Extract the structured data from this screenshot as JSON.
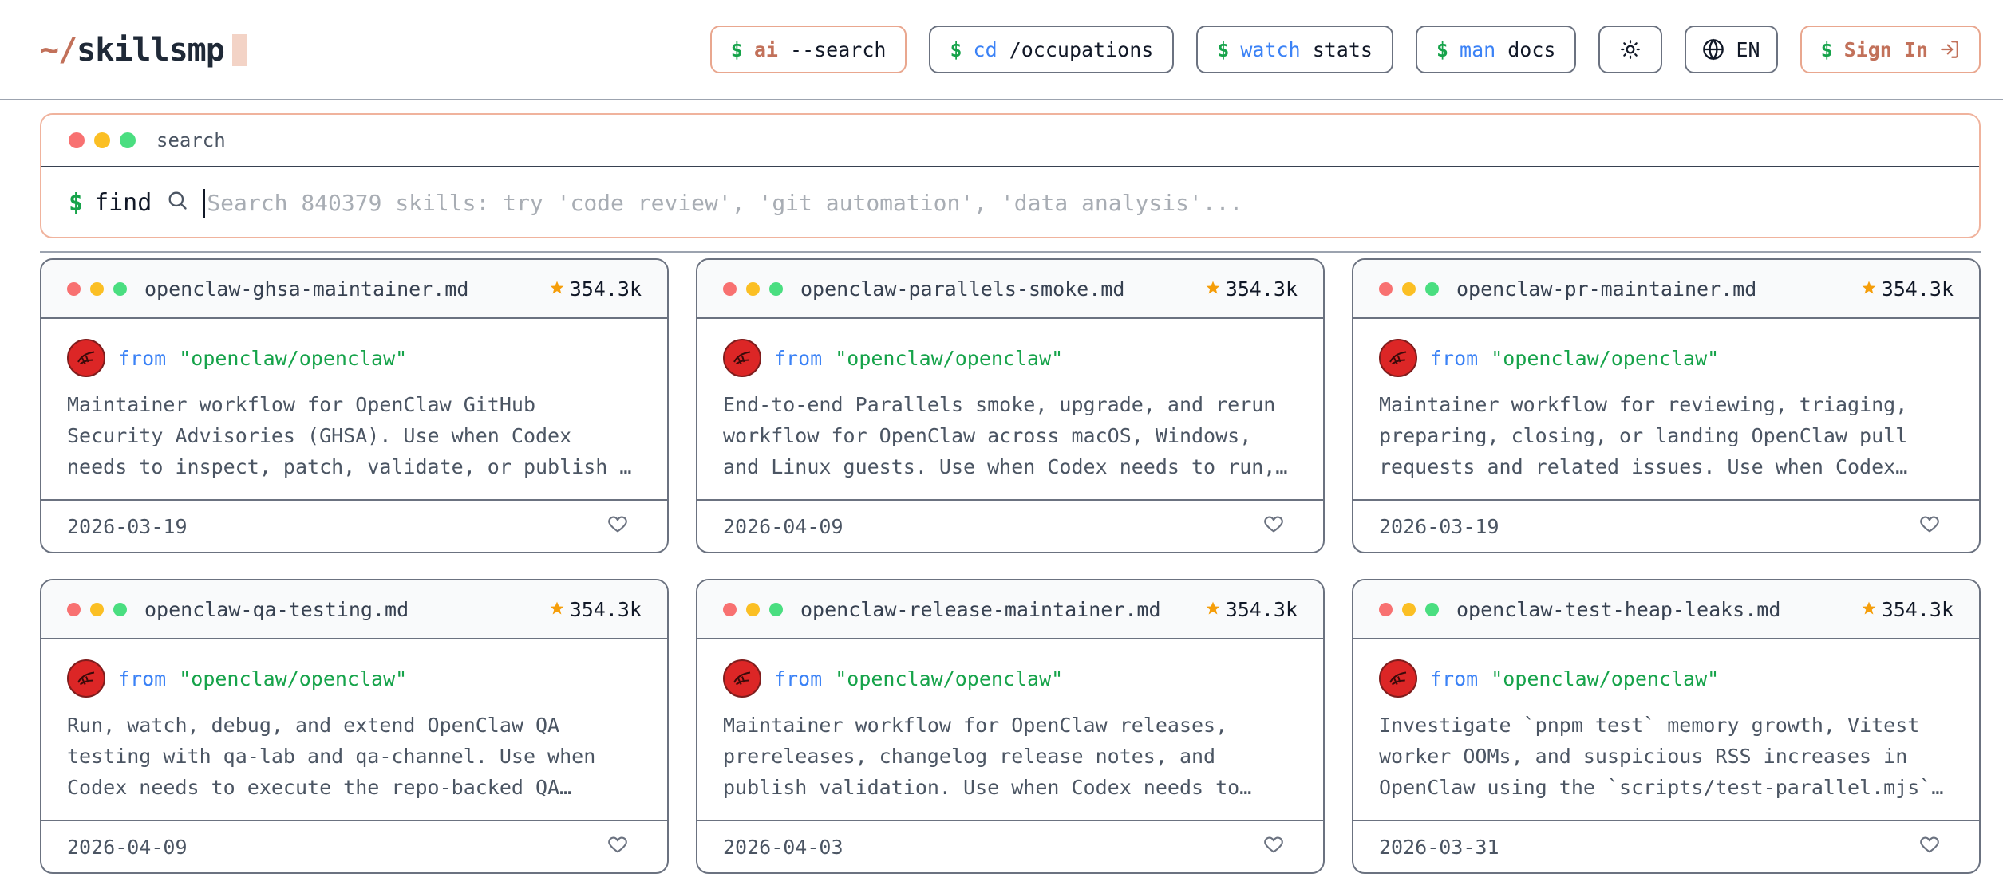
{
  "logo": {
    "tilde": "~/",
    "name": "skillsmp"
  },
  "nav": {
    "ai_search": {
      "prompt": "$",
      "cmd": "ai",
      "arg": "--search"
    },
    "occupations": {
      "prompt": "$",
      "cmd": "cd",
      "arg": "/occupations"
    },
    "stats": {
      "prompt": "$",
      "cmd": "watch",
      "arg": "stats"
    },
    "docs": {
      "prompt": "$",
      "cmd": "man",
      "arg": "docs"
    },
    "theme_icon": "sun-icon",
    "language": {
      "icon": "globe-icon",
      "label": "EN"
    },
    "signin": {
      "prompt": "$",
      "label": "Sign In",
      "icon": "sign-in-icon"
    }
  },
  "search": {
    "title": "search",
    "prompt": "$",
    "command": "find",
    "placeholder": "Search 840379 skills: try 'code review', 'git automation', 'data analysis'..."
  },
  "cards": [
    {
      "file": "openclaw-ghsa-maintainer.md",
      "stars": "354.3k",
      "from": "from",
      "repo": "\"openclaw/openclaw\"",
      "desc": "Maintainer workflow for OpenClaw GitHub Security Advisories (GHSA). Use when Codex needs to inspect, patch, validate, or publish a repo…",
      "date": "2026-03-19"
    },
    {
      "file": "openclaw-parallels-smoke.md",
      "stars": "354.3k",
      "from": "from",
      "repo": "\"openclaw/openclaw\"",
      "desc": "End-to-end Parallels smoke, upgrade, and rerun workflow for OpenClaw across macOS, Windows, and Linux guests. Use when Codex needs to run, rerun,…",
      "date": "2026-04-09"
    },
    {
      "file": "openclaw-pr-maintainer.md",
      "stars": "354.3k",
      "from": "from",
      "repo": "\"openclaw/openclaw\"",
      "desc": "Maintainer workflow for reviewing, triaging, preparing, closing, or landing OpenClaw pull requests and related issues. Use when Codex needs…",
      "date": "2026-03-19"
    },
    {
      "file": "openclaw-qa-testing.md",
      "stars": "354.3k",
      "from": "from",
      "repo": "\"openclaw/openclaw\"",
      "desc": "Run, watch, debug, and extend OpenClaw QA testing with qa-lab and qa-channel. Use when Codex needs to execute the repo-backed QA suite, inspect live…",
      "date": "2026-04-09"
    },
    {
      "file": "openclaw-release-maintainer.md",
      "stars": "354.3k",
      "from": "from",
      "repo": "\"openclaw/openclaw\"",
      "desc": "Maintainer workflow for OpenClaw releases, prereleases, changelog release notes, and publish validation. Use when Codex needs to prepare or…",
      "date": "2026-04-03"
    },
    {
      "file": "openclaw-test-heap-leaks.md",
      "stars": "354.3k",
      "from": "from",
      "repo": "\"openclaw/openclaw\"",
      "desc": "Investigate `pnpm test` memory growth, Vitest worker OOMs, and suspicious RSS increases in OpenClaw using the `scripts/test-parallel.mjs`…",
      "date": "2026-03-31"
    }
  ],
  "colors": {
    "accent": "#c2715a",
    "prompt_green": "#16a34a",
    "keyword_blue": "#3b82f6",
    "star": "#f59e0b"
  }
}
